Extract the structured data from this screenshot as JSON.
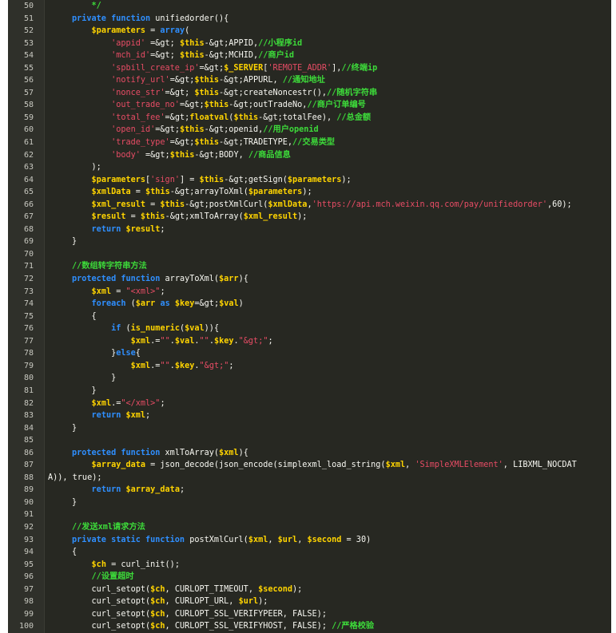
{
  "colors": {
    "background": "#272822",
    "keyword": "#2f8fff",
    "variable": "#ffd400",
    "string": "#e74c65",
    "comment": "#3ddb3a",
    "text": "#f8f8f2"
  },
  "editor": {
    "lines": [
      {
        "n": "50",
        "i": 0,
        "s": [
          [
            "cm",
            "    */"
          ]
        ]
      },
      {
        "n": "51",
        "i": 0,
        "s": [
          [
            "kw",
            "private function "
          ],
          [
            "txt",
            "unifiedorder(){"
          ]
        ]
      },
      {
        "n": "52",
        "i": 0,
        "s": [
          [
            "txt",
            "    "
          ],
          [
            "var",
            "$parameters"
          ],
          [
            "txt",
            " = "
          ],
          [
            "kw",
            "array"
          ],
          [
            "txt",
            "("
          ]
        ]
      },
      {
        "n": "53",
        "i": 0,
        "s": [
          [
            "txt",
            "        "
          ],
          [
            "str",
            "'appid'"
          ],
          [
            "txt",
            " =&gt; "
          ],
          [
            "var",
            "$this"
          ],
          [
            "txt",
            "-&gt;APPID,"
          ],
          [
            "cm",
            "//小程序id"
          ]
        ]
      },
      {
        "n": "54",
        "i": 0,
        "s": [
          [
            "txt",
            "        "
          ],
          [
            "str",
            "'mch_id'"
          ],
          [
            "txt",
            "=&gt; "
          ],
          [
            "var",
            "$this"
          ],
          [
            "txt",
            "-&gt;MCHID,"
          ],
          [
            "cm",
            "//商户id"
          ]
        ]
      },
      {
        "n": "55",
        "i": 0,
        "s": [
          [
            "txt",
            "        "
          ],
          [
            "str",
            "'spbill_create_ip'"
          ],
          [
            "txt",
            "=&gt;"
          ],
          [
            "var",
            "$_SERVER"
          ],
          [
            "txt",
            "["
          ],
          [
            "str",
            "'REMOTE_ADDR'"
          ],
          [
            "txt",
            "],"
          ],
          [
            "cm",
            "//终端ip"
          ]
        ]
      },
      {
        "n": "56",
        "i": 0,
        "s": [
          [
            "txt",
            "        "
          ],
          [
            "str",
            "'notify_url'"
          ],
          [
            "txt",
            "=&gt;"
          ],
          [
            "var",
            "$this"
          ],
          [
            "txt",
            "-&gt;APPURL, "
          ],
          [
            "cm",
            "//通知地址"
          ]
        ]
      },
      {
        "n": "57",
        "i": 0,
        "s": [
          [
            "txt",
            "        "
          ],
          [
            "str",
            "'nonce_str'"
          ],
          [
            "txt",
            "=&gt; "
          ],
          [
            "var",
            "$this"
          ],
          [
            "txt",
            "-&gt;createNoncestr(),"
          ],
          [
            "cm",
            "//随机字符串"
          ]
        ]
      },
      {
        "n": "58",
        "i": 0,
        "s": [
          [
            "txt",
            "        "
          ],
          [
            "str",
            "'out_trade_no'"
          ],
          [
            "txt",
            "=&gt;"
          ],
          [
            "var",
            "$this"
          ],
          [
            "txt",
            "-&gt;outTradeNo,"
          ],
          [
            "cm",
            "//商户订单编号"
          ]
        ]
      },
      {
        "n": "59",
        "i": 0,
        "s": [
          [
            "txt",
            "        "
          ],
          [
            "str",
            "'total_fee'"
          ],
          [
            "txt",
            "=&gt;"
          ],
          [
            "var",
            "floatval"
          ],
          [
            "txt",
            "("
          ],
          [
            "var",
            "$this"
          ],
          [
            "txt",
            "-&gt;totalFee), "
          ],
          [
            "cm",
            "//总金额"
          ]
        ]
      },
      {
        "n": "60",
        "i": 0,
        "s": [
          [
            "txt",
            "        "
          ],
          [
            "str",
            "'open_id'"
          ],
          [
            "txt",
            "=&gt;"
          ],
          [
            "var",
            "$this"
          ],
          [
            "txt",
            "-&gt;openid,"
          ],
          [
            "cm",
            "//用户openid"
          ]
        ]
      },
      {
        "n": "61",
        "i": 0,
        "s": [
          [
            "txt",
            "        "
          ],
          [
            "str",
            "'trade_type'"
          ],
          [
            "txt",
            "=&gt;"
          ],
          [
            "var",
            "$this"
          ],
          [
            "txt",
            "-&gt;TRADETYPE,"
          ],
          [
            "cm",
            "//交易类型"
          ]
        ]
      },
      {
        "n": "62",
        "i": 0,
        "s": [
          [
            "txt",
            "        "
          ],
          [
            "str",
            "'body'"
          ],
          [
            "txt",
            " =&gt;"
          ],
          [
            "var",
            "$this"
          ],
          [
            "txt",
            "-&gt;BODY, "
          ],
          [
            "cm",
            "//商品信息"
          ]
        ]
      },
      {
        "n": "63",
        "i": 0,
        "s": [
          [
            "txt",
            "    );"
          ]
        ]
      },
      {
        "n": "64",
        "i": 0,
        "s": [
          [
            "txt",
            "    "
          ],
          [
            "var",
            "$parameters"
          ],
          [
            "txt",
            "["
          ],
          [
            "str",
            "'sign'"
          ],
          [
            "txt",
            "] = "
          ],
          [
            "var",
            "$this"
          ],
          [
            "txt",
            "-&gt;getSign("
          ],
          [
            "var",
            "$parameters"
          ],
          [
            "txt",
            ");"
          ]
        ]
      },
      {
        "n": "65",
        "i": 0,
        "s": [
          [
            "txt",
            "    "
          ],
          [
            "var",
            "$xmlData"
          ],
          [
            "txt",
            " = "
          ],
          [
            "var",
            "$this"
          ],
          [
            "txt",
            "-&gt;arrayToXml("
          ],
          [
            "var",
            "$parameters"
          ],
          [
            "txt",
            ");"
          ]
        ]
      },
      {
        "n": "66",
        "i": 0,
        "s": [
          [
            "txt",
            "    "
          ],
          [
            "var",
            "$xml_result"
          ],
          [
            "txt",
            " = "
          ],
          [
            "var",
            "$this"
          ],
          [
            "txt",
            "-&gt;postXmlCurl("
          ],
          [
            "var",
            "$xmlData"
          ],
          [
            "txt",
            ","
          ],
          [
            "str",
            "'https://api.mch.weixin.qq.com/pay/unifiedorder'"
          ],
          [
            "txt",
            ",60);"
          ]
        ]
      },
      {
        "n": "67",
        "i": 0,
        "s": [
          [
            "txt",
            "    "
          ],
          [
            "var",
            "$result"
          ],
          [
            "txt",
            " = "
          ],
          [
            "var",
            "$this"
          ],
          [
            "txt",
            "-&gt;xmlToArray("
          ],
          [
            "var",
            "$xml_result"
          ],
          [
            "txt",
            ");"
          ]
        ]
      },
      {
        "n": "68",
        "i": 0,
        "s": [
          [
            "txt",
            "    "
          ],
          [
            "kw",
            "return "
          ],
          [
            "var",
            "$result"
          ],
          [
            "txt",
            ";"
          ]
        ]
      },
      {
        "n": "69",
        "i": 0,
        "s": [
          [
            "txt",
            "}"
          ]
        ]
      },
      {
        "n": "70",
        "i": 0,
        "s": []
      },
      {
        "n": "71",
        "i": 0,
        "s": [
          [
            "cm",
            "//数组转字符串方法"
          ]
        ]
      },
      {
        "n": "72",
        "i": 0,
        "s": [
          [
            "kw",
            "protected function "
          ],
          [
            "txt",
            "arrayToXml("
          ],
          [
            "var",
            "$arr"
          ],
          [
            "txt",
            "){"
          ]
        ]
      },
      {
        "n": "73",
        "i": 0,
        "s": [
          [
            "txt",
            "    "
          ],
          [
            "var",
            "$xml"
          ],
          [
            "txt",
            " = "
          ],
          [
            "str",
            "\"<xml>\""
          ],
          [
            "txt",
            ";"
          ]
        ]
      },
      {
        "n": "74",
        "i": 0,
        "s": [
          [
            "txt",
            "    "
          ],
          [
            "kw",
            "foreach"
          ],
          [
            "txt",
            " ("
          ],
          [
            "var",
            "$arr"
          ],
          [
            "kw",
            " as "
          ],
          [
            "var",
            "$key"
          ],
          [
            "txt",
            "=&gt;"
          ],
          [
            "var",
            "$val"
          ],
          [
            "txt",
            ")"
          ]
        ]
      },
      {
        "n": "75",
        "i": 0,
        "s": [
          [
            "txt",
            "    {"
          ]
        ]
      },
      {
        "n": "76",
        "i": 0,
        "s": [
          [
            "txt",
            "        "
          ],
          [
            "kw",
            "if"
          ],
          [
            "txt",
            " ("
          ],
          [
            "var",
            "is_numeric"
          ],
          [
            "txt",
            "("
          ],
          [
            "var",
            "$val"
          ],
          [
            "txt",
            ")){"
          ]
        ]
      },
      {
        "n": "77",
        "i": 0,
        "s": [
          [
            "txt",
            "            "
          ],
          [
            "var",
            "$xml"
          ],
          [
            "txt",
            ".="
          ],
          [
            "str",
            "\"\""
          ],
          [
            "txt",
            "."
          ],
          [
            "var",
            "$val"
          ],
          [
            "txt",
            "."
          ],
          [
            "str",
            "\"\""
          ],
          [
            "txt",
            "."
          ],
          [
            "var",
            "$key"
          ],
          [
            "txt",
            "."
          ],
          [
            "str",
            "\"&gt;\""
          ],
          [
            "txt",
            ";"
          ]
        ]
      },
      {
        "n": "78",
        "i": 0,
        "s": [
          [
            "txt",
            "        }"
          ],
          [
            "kw",
            "else"
          ],
          [
            "txt",
            "{"
          ]
        ]
      },
      {
        "n": "79",
        "i": 0,
        "s": [
          [
            "txt",
            "            "
          ],
          [
            "var",
            "$xml"
          ],
          [
            "txt",
            ".="
          ],
          [
            "str",
            "\"\""
          ],
          [
            "txt",
            "."
          ],
          [
            "var",
            "$key"
          ],
          [
            "txt",
            "."
          ],
          [
            "str",
            "\"&gt;\""
          ],
          [
            "txt",
            ";"
          ]
        ]
      },
      {
        "n": "80",
        "i": 0,
        "s": [
          [
            "txt",
            "        }"
          ]
        ]
      },
      {
        "n": "81",
        "i": 0,
        "s": [
          [
            "txt",
            "    }"
          ]
        ]
      },
      {
        "n": "82",
        "i": 0,
        "s": [
          [
            "txt",
            "    "
          ],
          [
            "var",
            "$xml"
          ],
          [
            "txt",
            ".="
          ],
          [
            "str",
            "\"</xml>\""
          ],
          [
            "txt",
            ";"
          ]
        ]
      },
      {
        "n": "83",
        "i": 0,
        "s": [
          [
            "txt",
            "    "
          ],
          [
            "kw",
            "return "
          ],
          [
            "var",
            "$xml"
          ],
          [
            "txt",
            ";"
          ]
        ]
      },
      {
        "n": "84",
        "i": 0,
        "s": [
          [
            "txt",
            "}"
          ]
        ]
      },
      {
        "n": "85",
        "i": 0,
        "s": []
      },
      {
        "n": "86",
        "i": 0,
        "s": [
          [
            "kw",
            "protected function "
          ],
          [
            "txt",
            "xmlToArray("
          ],
          [
            "var",
            "$xml"
          ],
          [
            "txt",
            "){"
          ]
        ]
      },
      {
        "n": "87",
        "i": 0,
        "s": [
          [
            "txt",
            "    "
          ],
          [
            "var",
            "$array_data"
          ],
          [
            "txt",
            " = json_decode(json_encode(simplexml_load_string("
          ],
          [
            "var",
            "$xml"
          ],
          [
            "txt",
            ", "
          ],
          [
            "str",
            "'SimpleXMLElement'"
          ],
          [
            "txt",
            ", LIBXML_NOCDAT"
          ]
        ]
      },
      {
        "n": "88",
        "i": 0,
        "s": [
          [
            "txt",
            "A)), true);"
          ]
        ]
      },
      {
        "n": "89",
        "i": 0,
        "s": [
          [
            "txt",
            "    "
          ],
          [
            "kw",
            "return "
          ],
          [
            "var",
            "$array_data"
          ],
          [
            "txt",
            ";"
          ]
        ]
      },
      {
        "n": "90",
        "i": 0,
        "s": [
          [
            "txt",
            "}"
          ]
        ]
      },
      {
        "n": "91",
        "i": 0,
        "s": []
      },
      {
        "n": "92",
        "i": 0,
        "s": [
          [
            "cm",
            "//发送xml请求方法"
          ]
        ]
      },
      {
        "n": "93",
        "i": 0,
        "s": [
          [
            "kw",
            "private static function "
          ],
          [
            "txt",
            "postXmlCurl("
          ],
          [
            "var",
            "$xml"
          ],
          [
            "txt",
            ", "
          ],
          [
            "var",
            "$url"
          ],
          [
            "txt",
            ", "
          ],
          [
            "var",
            "$second"
          ],
          [
            "txt",
            " = 30)"
          ]
        ]
      },
      {
        "n": "94",
        "i": 0,
        "s": [
          [
            "txt",
            "{"
          ]
        ]
      },
      {
        "n": "95",
        "i": 0,
        "s": [
          [
            "txt",
            "    "
          ],
          [
            "var",
            "$ch"
          ],
          [
            "txt",
            " = curl_init();"
          ]
        ]
      },
      {
        "n": "96",
        "i": 0,
        "s": [
          [
            "txt",
            "    "
          ],
          [
            "cm",
            "//设置超时"
          ]
        ]
      },
      {
        "n": "97",
        "i": 0,
        "s": [
          [
            "txt",
            "    curl_setopt("
          ],
          [
            "var",
            "$ch"
          ],
          [
            "txt",
            ", CURLOPT_TIMEOUT, "
          ],
          [
            "var",
            "$second"
          ],
          [
            "txt",
            ");"
          ]
        ]
      },
      {
        "n": "98",
        "i": 0,
        "s": [
          [
            "txt",
            "    curl_setopt("
          ],
          [
            "var",
            "$ch"
          ],
          [
            "txt",
            ", CURLOPT_URL, "
          ],
          [
            "var",
            "$url"
          ],
          [
            "txt",
            ");"
          ]
        ]
      },
      {
        "n": "99",
        "i": 0,
        "s": [
          [
            "txt",
            "    curl_setopt("
          ],
          [
            "var",
            "$ch"
          ],
          [
            "txt",
            ", CURLOPT_SSL_VERIFYPEER, FALSE);"
          ]
        ]
      },
      {
        "n": "100",
        "i": 0,
        "s": [
          [
            "txt",
            "    curl_setopt("
          ],
          [
            "var",
            "$ch"
          ],
          [
            "txt",
            ", CURLOPT_SSL_VERIFYHOST, FALSE); "
          ],
          [
            "cm",
            "//严格校验"
          ]
        ]
      }
    ]
  }
}
